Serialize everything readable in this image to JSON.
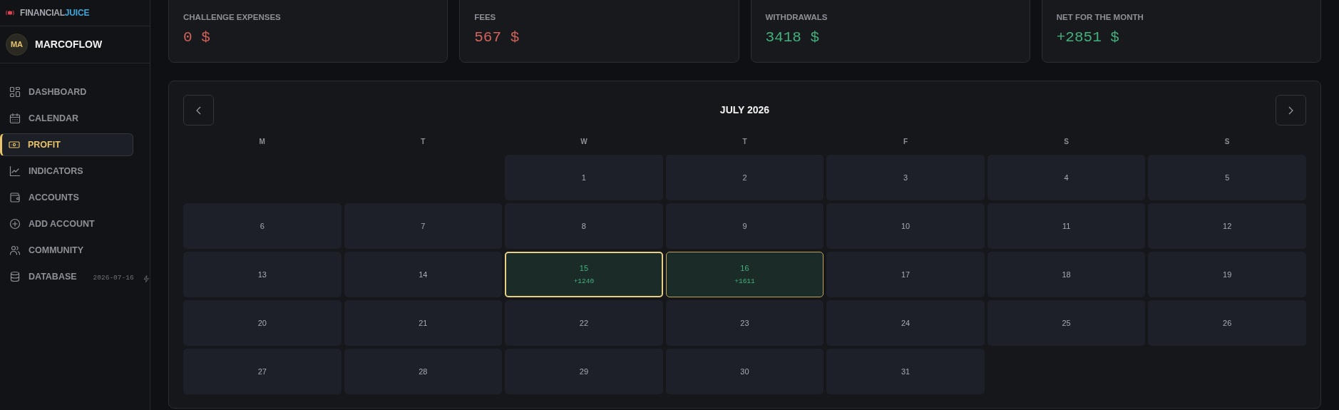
{
  "brand": {
    "name": "FINANCIAL",
    "accent": "JUICE"
  },
  "user": {
    "initials": "MA",
    "name": "MARCOFLOW"
  },
  "nav": [
    {
      "label": "DASHBOARD",
      "selected": false
    },
    {
      "label": "CALENDAR",
      "selected": false
    },
    {
      "label": "PROFIT",
      "selected": true
    },
    {
      "label": "INDICATORS",
      "selected": false
    },
    {
      "label": "ACCOUNTS",
      "selected": false
    },
    {
      "label": "ADD ACCOUNT",
      "selected": false
    },
    {
      "label": "COMMUNITY",
      "selected": false
    },
    {
      "label": "DATABASE",
      "selected": false,
      "note": "2026-07-16"
    }
  ],
  "stats": [
    {
      "label": "CHALLENGE EXPENSES",
      "value": "0 $",
      "color": "#d0625a"
    },
    {
      "label": "FEES",
      "value": "567 $",
      "color": "#d0625a"
    },
    {
      "label": "WITHDRAWALS",
      "value": "3418 $",
      "color": "#43b07c"
    },
    {
      "label": "NET FOR THE MONTH",
      "value": "+2851 $",
      "color": "#43b07c"
    }
  ],
  "calendar": {
    "title": "JULY 2026",
    "weekdays": [
      "M",
      "T",
      "W",
      "T",
      "F",
      "S",
      "S"
    ],
    "cells": [
      {
        "kind": "empty"
      },
      {
        "kind": "empty"
      },
      {
        "kind": "day",
        "day": "1",
        "selected": false,
        "today": false
      },
      {
        "kind": "day",
        "day": "2",
        "selected": false,
        "today": false
      },
      {
        "kind": "day",
        "day": "3",
        "selected": false,
        "today": false
      },
      {
        "kind": "day",
        "day": "4",
        "selected": false,
        "today": false
      },
      {
        "kind": "day",
        "day": "5",
        "selected": false,
        "today": false
      },
      {
        "kind": "day",
        "day": "6",
        "selected": false,
        "today": false
      },
      {
        "kind": "day",
        "day": "7",
        "selected": false,
        "today": false
      },
      {
        "kind": "day",
        "day": "8",
        "selected": false,
        "today": false
      },
      {
        "kind": "day",
        "day": "9",
        "selected": false,
        "today": false
      },
      {
        "kind": "day",
        "day": "10",
        "selected": false,
        "today": false
      },
      {
        "kind": "day",
        "day": "11",
        "selected": false,
        "today": false
      },
      {
        "kind": "day",
        "day": "12",
        "selected": false,
        "today": false
      },
      {
        "kind": "day",
        "day": "13",
        "selected": false,
        "today": false
      },
      {
        "kind": "day",
        "day": "14",
        "selected": false,
        "today": false
      },
      {
        "kind": "day",
        "day": "15",
        "pnl": "+1240",
        "selected": true,
        "today": false
      },
      {
        "kind": "day",
        "day": "16",
        "pnl": "+1611",
        "selected": false,
        "today": true
      },
      {
        "kind": "day",
        "day": "17",
        "selected": false,
        "today": false
      },
      {
        "kind": "day",
        "day": "18",
        "selected": false,
        "today": false
      },
      {
        "kind": "day",
        "day": "19",
        "selected": false,
        "today": false
      },
      {
        "kind": "day",
        "day": "20",
        "selected": false,
        "today": false
      },
      {
        "kind": "day",
        "day": "21",
        "selected": false,
        "today": false
      },
      {
        "kind": "day",
        "day": "22",
        "selected": false,
        "today": false
      },
      {
        "kind": "day",
        "day": "23",
        "selected": false,
        "today": false
      },
      {
        "kind": "day",
        "day": "24",
        "selected": false,
        "today": false
      },
      {
        "kind": "day",
        "day": "25",
        "selected": false,
        "today": false
      },
      {
        "kind": "day",
        "day": "26",
        "selected": false,
        "today": false
      },
      {
        "kind": "day",
        "day": "27",
        "selected": false,
        "today": false
      },
      {
        "kind": "day",
        "day": "28",
        "selected": false,
        "today": false
      },
      {
        "kind": "day",
        "day": "29",
        "selected": false,
        "today": false
      },
      {
        "kind": "day",
        "day": "30",
        "selected": false,
        "today": false
      },
      {
        "kind": "day",
        "day": "31",
        "selected": false,
        "today": false
      }
    ]
  }
}
